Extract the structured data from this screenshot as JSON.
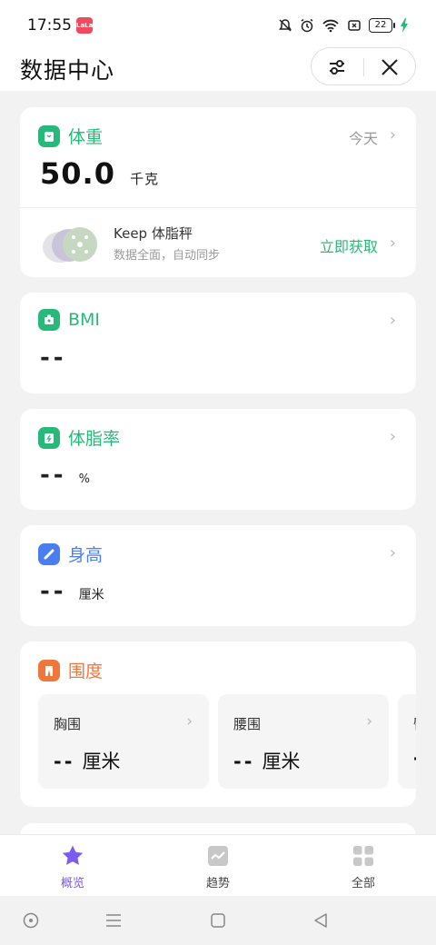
{
  "status_bar": {
    "time": "17:55",
    "app_badge": "LaLa",
    "battery": "22"
  },
  "header": {
    "title": "数据中心"
  },
  "weight": {
    "title": "体重",
    "date": "今天",
    "value": "50.0",
    "unit": "千克"
  },
  "promo": {
    "title": "Keep 体脂秤",
    "subtitle": "数据全面，自动同步",
    "action": "立即获取"
  },
  "bmi": {
    "title": "BMI",
    "value": "--"
  },
  "body_fat": {
    "title": "体脂率",
    "value": "--",
    "unit": "%"
  },
  "height": {
    "title": "身高",
    "value": "--",
    "unit": "厘米"
  },
  "girth": {
    "title": "围度",
    "items": [
      {
        "title": "胸围",
        "value": "--",
        "unit": "厘米"
      },
      {
        "title": "腰围",
        "value": "--",
        "unit": "厘米"
      },
      {
        "title": "臀",
        "value": "-",
        "unit": ""
      }
    ]
  },
  "bottom_nav": {
    "items": [
      {
        "label": "概览",
        "icon": "star-icon",
        "active": true
      },
      {
        "label": "趋势",
        "icon": "trend-icon",
        "active": false
      },
      {
        "label": "全部",
        "icon": "grid-icon",
        "active": false
      }
    ]
  },
  "colors": {
    "green": "#26b97a",
    "blue": "#4a7ef0",
    "orange": "#f0773c",
    "purple": "#7b5cf0"
  }
}
